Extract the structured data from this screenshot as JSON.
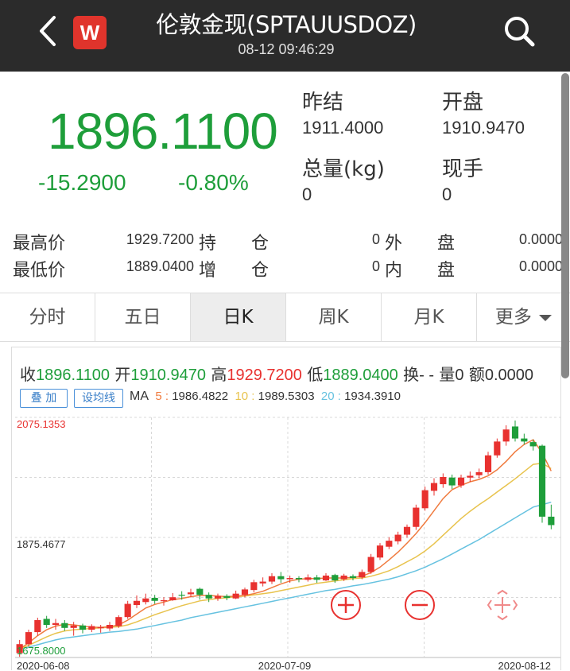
{
  "header": {
    "title": "伦敦金现(SPTAUUSDOZ)",
    "datetime": "08-12 09:46:29",
    "logo_letter": "W"
  },
  "quote": {
    "price": "1896.1100",
    "change": "-15.2900",
    "change_pct": "-0.80%",
    "prev_close_label": "昨结",
    "prev_close": "1911.4000",
    "open_label": "开盘",
    "open": "1910.9470",
    "volume_label": "总量(kg)",
    "volume": "0",
    "current_hand_label": "现手",
    "current_hand": "0",
    "high_label": "最高价",
    "high": "1929.7200",
    "low_label": "最低价",
    "low": "1889.0400",
    "hold_label": "持　　仓",
    "hold": "0",
    "add_label": "增　　仓",
    "add": "0",
    "outer_label": "外　　盘",
    "outer": "0.0000",
    "inner_label": "内　　盘",
    "inner": "0.0000"
  },
  "tabs": [
    {
      "label": "分时"
    },
    {
      "label": "五日"
    },
    {
      "label": "日K"
    },
    {
      "label": "周K"
    },
    {
      "label": "月K"
    },
    {
      "label": "更多"
    }
  ],
  "active_tab": 2,
  "chart_info": {
    "close_label": "收",
    "close": "1896.1100",
    "open_label": "开",
    "open": "1910.9470",
    "high_label": "高",
    "high": "1929.7200",
    "low_label": "低",
    "low": "1889.0400",
    "turnover_label": "换",
    "turnover": "- -",
    "vol_label": "量",
    "vol": "0",
    "amount_label": "额",
    "amount": "0.0000",
    "overlay_btn": "叠 加",
    "ma_setting_btn": "设均线",
    "ma_label": "MA",
    "ma5_label": "5 : ",
    "ma5": "1986.4822",
    "ma10_label": "10 : ",
    "ma10": "1989.5303",
    "ma20_label": "20 : ",
    "ma20": "1934.3910"
  },
  "colors": {
    "up": "#e8312f",
    "down": "#1e9e3a",
    "ma5": "#f07b3f",
    "ma10": "#e8c34d",
    "ma20": "#66c2e0",
    "grid": "#d8d8d8"
  },
  "chart_data": {
    "type": "candlestick",
    "y_ticks": [
      "2075.1353",
      "1875.4677",
      "1675.8000"
    ],
    "x_ticks": [
      "2020-06-08",
      "2020-07-09",
      "2020-08-12"
    ],
    "ylim": [
      1675.8,
      2075.1353
    ],
    "candles": [
      {
        "o": 1683,
        "c": 1698,
        "h": 1705,
        "l": 1677
      },
      {
        "o": 1698,
        "c": 1718,
        "h": 1722,
        "l": 1694
      },
      {
        "o": 1718,
        "c": 1738,
        "h": 1742,
        "l": 1712
      },
      {
        "o": 1740,
        "c": 1730,
        "h": 1745,
        "l": 1725
      },
      {
        "o": 1730,
        "c": 1733,
        "h": 1740,
        "l": 1722
      },
      {
        "o": 1733,
        "c": 1725,
        "h": 1738,
        "l": 1720
      },
      {
        "o": 1725,
        "c": 1729,
        "h": 1735,
        "l": 1712
      },
      {
        "o": 1729,
        "c": 1722,
        "h": 1732,
        "l": 1716
      },
      {
        "o": 1722,
        "c": 1728,
        "h": 1731,
        "l": 1718
      },
      {
        "o": 1726,
        "c": 1726,
        "h": 1730,
        "l": 1717
      },
      {
        "o": 1724,
        "c": 1730,
        "h": 1735,
        "l": 1720
      },
      {
        "o": 1728,
        "c": 1743,
        "h": 1746,
        "l": 1725
      },
      {
        "o": 1743,
        "c": 1765,
        "h": 1770,
        "l": 1740
      },
      {
        "o": 1763,
        "c": 1770,
        "h": 1779,
        "l": 1758
      },
      {
        "o": 1768,
        "c": 1774,
        "h": 1782,
        "l": 1764
      },
      {
        "o": 1775,
        "c": 1770,
        "h": 1780,
        "l": 1765
      },
      {
        "o": 1770,
        "c": 1771,
        "h": 1776,
        "l": 1762
      },
      {
        "o": 1771,
        "c": 1776,
        "h": 1783,
        "l": 1770
      },
      {
        "o": 1780,
        "c": 1779,
        "h": 1786,
        "l": 1772
      },
      {
        "o": 1781,
        "c": 1784,
        "h": 1790,
        "l": 1776
      },
      {
        "o": 1790,
        "c": 1780,
        "h": 1792,
        "l": 1772
      },
      {
        "o": 1780,
        "c": 1774,
        "h": 1784,
        "l": 1768
      },
      {
        "o": 1774,
        "c": 1778,
        "h": 1782,
        "l": 1770
      },
      {
        "o": 1778,
        "c": 1775,
        "h": 1781,
        "l": 1771
      },
      {
        "o": 1774,
        "c": 1782,
        "h": 1787,
        "l": 1773
      },
      {
        "o": 1780,
        "c": 1789,
        "h": 1792,
        "l": 1776
      },
      {
        "o": 1788,
        "c": 1801,
        "h": 1805,
        "l": 1784
      },
      {
        "o": 1799,
        "c": 1802,
        "h": 1809,
        "l": 1794
      },
      {
        "o": 1802,
        "c": 1811,
        "h": 1816,
        "l": 1798
      },
      {
        "o": 1811,
        "c": 1806,
        "h": 1818,
        "l": 1800
      },
      {
        "o": 1806,
        "c": 1808,
        "h": 1812,
        "l": 1800
      },
      {
        "o": 1808,
        "c": 1806,
        "h": 1811,
        "l": 1801
      },
      {
        "o": 1805,
        "c": 1809,
        "h": 1814,
        "l": 1802
      },
      {
        "o": 1809,
        "c": 1805,
        "h": 1813,
        "l": 1800
      },
      {
        "o": 1804,
        "c": 1812,
        "h": 1816,
        "l": 1803
      },
      {
        "o": 1813,
        "c": 1804,
        "h": 1815,
        "l": 1800
      },
      {
        "o": 1806,
        "c": 1812,
        "h": 1815,
        "l": 1803
      },
      {
        "o": 1811,
        "c": 1808,
        "h": 1814,
        "l": 1804
      },
      {
        "o": 1809,
        "c": 1818,
        "h": 1822,
        "l": 1806
      },
      {
        "o": 1818,
        "c": 1843,
        "h": 1848,
        "l": 1815
      },
      {
        "o": 1842,
        "c": 1862,
        "h": 1866,
        "l": 1838
      },
      {
        "o": 1860,
        "c": 1870,
        "h": 1876,
        "l": 1856
      },
      {
        "o": 1869,
        "c": 1880,
        "h": 1885,
        "l": 1864
      },
      {
        "o": 1880,
        "c": 1893,
        "h": 1897,
        "l": 1875
      },
      {
        "o": 1893,
        "c": 1925,
        "h": 1930,
        "l": 1888
      },
      {
        "o": 1924,
        "c": 1954,
        "h": 1960,
        "l": 1920
      },
      {
        "o": 1953,
        "c": 1966,
        "h": 1974,
        "l": 1945
      },
      {
        "o": 1964,
        "c": 1976,
        "h": 1982,
        "l": 1958
      },
      {
        "o": 1975,
        "c": 1962,
        "h": 1980,
        "l": 1956
      },
      {
        "o": 1962,
        "c": 1975,
        "h": 1980,
        "l": 1958
      },
      {
        "o": 1975,
        "c": 1978,
        "h": 1985,
        "l": 1968
      },
      {
        "o": 1979,
        "c": 1984,
        "h": 1990,
        "l": 1974
      },
      {
        "o": 1984,
        "c": 2012,
        "h": 2018,
        "l": 1980
      },
      {
        "o": 2012,
        "c": 2035,
        "h": 2040,
        "l": 2008
      },
      {
        "o": 2035,
        "c": 2055,
        "h": 2062,
        "l": 2028
      },
      {
        "o": 2060,
        "c": 2040,
        "h": 2070,
        "l": 2035
      },
      {
        "o": 2040,
        "c": 2035,
        "h": 2048,
        "l": 2030
      },
      {
        "o": 2034,
        "c": 2027,
        "h": 2038,
        "l": 2020
      },
      {
        "o": 2028,
        "c": 1910,
        "h": 2030,
        "l": 1900
      },
      {
        "o": 1910,
        "c": 1896,
        "h": 1930,
        "l": 1889
      }
    ],
    "ma5": [
      1690,
      1700,
      1712,
      1722,
      1728,
      1731,
      1730,
      1728,
      1726,
      1726,
      1727,
      1730,
      1738,
      1748,
      1758,
      1764,
      1768,
      1772,
      1774,
      1777,
      1779,
      1779,
      1778,
      1777,
      1778,
      1779,
      1782,
      1786,
      1792,
      1798,
      1803,
      1806,
      1807,
      1807,
      1808,
      1808,
      1808,
      1809,
      1811,
      1817,
      1826,
      1838,
      1851,
      1866,
      1882,
      1900,
      1920,
      1940,
      1955,
      1962,
      1968,
      1972,
      1978,
      1988,
      2002,
      2018,
      2030,
      2038,
      2016,
      1986
    ],
    "ma10": [
      1690,
      1696,
      1703,
      1710,
      1716,
      1720,
      1722,
      1723,
      1724,
      1725,
      1726,
      1727,
      1730,
      1735,
      1741,
      1747,
      1752,
      1757,
      1762,
      1766,
      1770,
      1772,
      1774,
      1775,
      1777,
      1778,
      1780,
      1782,
      1784,
      1787,
      1790,
      1793,
      1796,
      1799,
      1801,
      1803,
      1805,
      1807,
      1808,
      1811,
      1815,
      1820,
      1827,
      1835,
      1843,
      1853,
      1865,
      1879,
      1893,
      1907,
      1919,
      1930,
      1940,
      1951,
      1962,
      1973,
      1985,
      1997,
      1999,
      1990
    ],
    "ma20": [
      1690,
      1693,
      1697,
      1701,
      1705,
      1708,
      1710,
      1712,
      1714,
      1716,
      1718,
      1719,
      1721,
      1723,
      1726,
      1729,
      1732,
      1735,
      1738,
      1742,
      1745,
      1748,
      1751,
      1754,
      1757,
      1760,
      1763,
      1766,
      1769,
      1772,
      1775,
      1778,
      1781,
      1784,
      1787,
      1789,
      1792,
      1795,
      1797,
      1800,
      1803,
      1806,
      1810,
      1815,
      1820,
      1826,
      1833,
      1840,
      1848,
      1856,
      1864,
      1872,
      1881,
      1890,
      1899,
      1908,
      1917,
      1926,
      1930,
      1934
    ]
  }
}
